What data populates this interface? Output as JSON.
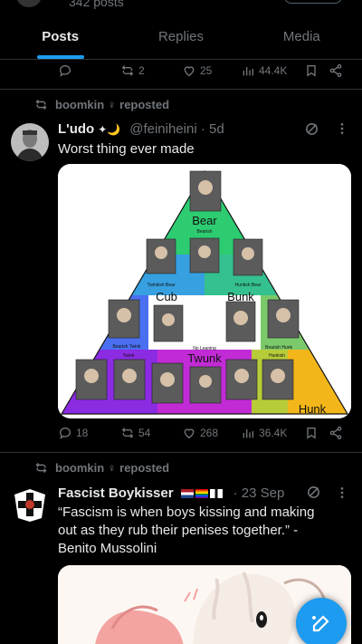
{
  "header": {
    "post_count": "342 posts"
  },
  "tabs": [
    {
      "label": "Posts",
      "active": true
    },
    {
      "label": "Replies",
      "active": false
    },
    {
      "label": "Media",
      "active": false
    }
  ],
  "top_actions": {
    "reposts": "2",
    "likes": "25",
    "views": "44.4K"
  },
  "post1": {
    "repost_by": "boomkin ♀ reposted",
    "author": "L'udo",
    "badges": "✦🌙",
    "handle": "@feiniheini · 5d",
    "text": "Worst thing ever made",
    "triangle": {
      "labels": {
        "top": "Bear",
        "left": "Cub",
        "right": "Bunk",
        "center": "Twunk",
        "bottom_right": "Hunk"
      },
      "sub_labels": {
        "top": "Bearish",
        "left": "Twinkish Bear",
        "right": "Huntish Bear",
        "center": "No Leaning",
        "left2": "Bearish Twink",
        "right2": "Bearish Hunk",
        "left_bottom": "Twink",
        "right_bottom": "Hunkish"
      }
    },
    "actions": {
      "replies": "18",
      "reposts": "54",
      "likes": "268",
      "views": "36.4K"
    }
  },
  "post2": {
    "repost_by": "boomkin ♀ reposted",
    "author": "Fascist Boykisser",
    "handle": "· 23 Sep",
    "text": "“Fascism is when boys kissing and making out as they rub their penises together.” - Benito Mussolini"
  },
  "colors": {
    "accent": "#1d9bf0",
    "muted": "#71767b",
    "divider": "#2f3336"
  },
  "icons": [
    "reply-icon",
    "repost-icon",
    "like-icon",
    "views-icon",
    "bookmark-icon",
    "share-icon",
    "grok-icon",
    "more-icon",
    "compose-icon"
  ]
}
